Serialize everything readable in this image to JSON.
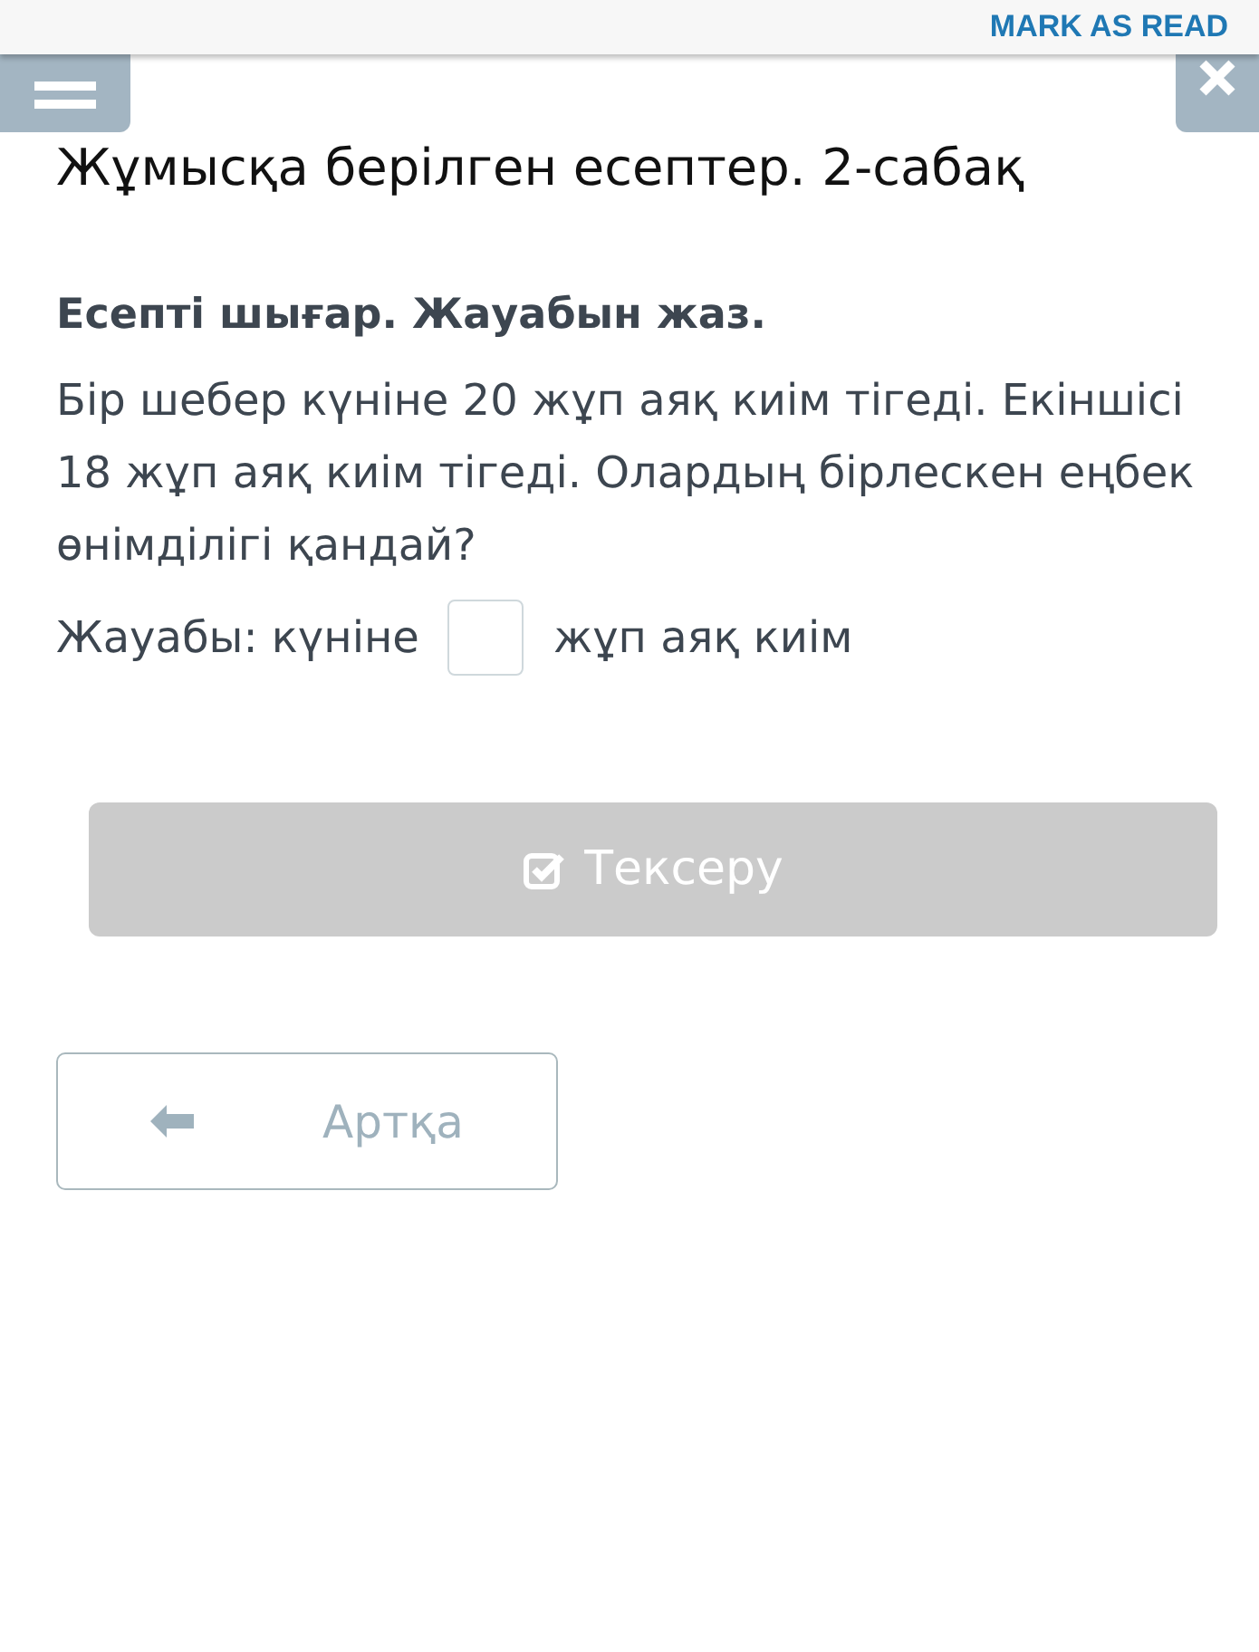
{
  "top_bar": {
    "action": "MARK AS READ"
  },
  "title": "Жұмысқа берілген есептер. 2-сабақ",
  "task": {
    "instruction": "Есепті шығар. Жауабын жаз.",
    "text": "Бір шебер күніне 20 жұп аяқ киім тігеді. Екіншісі 18 жұп аяқ киім тігеді. Олардың бірлескен еңбек өнімділігі қандай?",
    "answer_before": "Жауабы: күніне",
    "answer_after": "жұп аяқ киім"
  },
  "check_button": {
    "label": "Тексеру",
    "disabled": true
  },
  "back_button": {
    "label": "Артқа"
  }
}
